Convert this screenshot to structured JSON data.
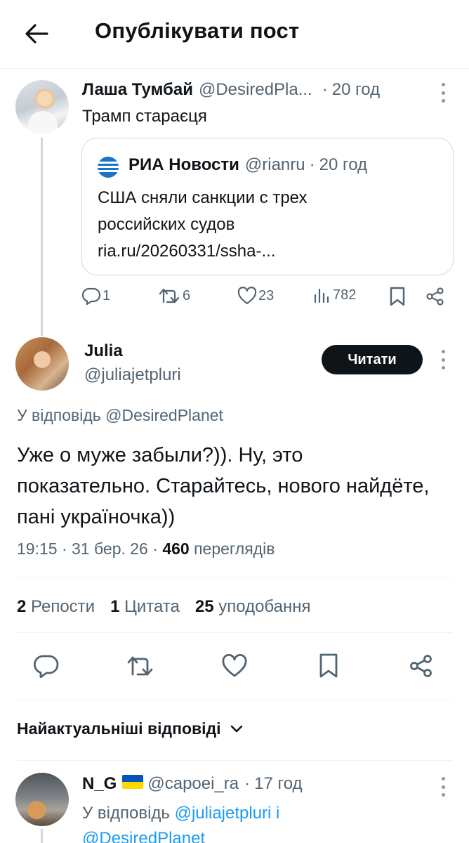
{
  "header": {
    "title": "Опублікувати пост",
    "back_icon": "arrow-left-icon"
  },
  "parent_post": {
    "name": "Лаша Тумбай",
    "handle": "@DesiredPla...",
    "time": "20 год",
    "text": "Трамп стараєця",
    "quote": {
      "name": "РИА Новости",
      "handle": "@rianru",
      "time": "20 год",
      "text_line1": "США сняли санкции с трех",
      "text_line2": "российских судов",
      "link": "ria.ru/20260331/ssha-..."
    },
    "actions": {
      "replies": "1",
      "reposts": "6",
      "likes": "23",
      "views": "782"
    }
  },
  "main_post": {
    "name": "Julia",
    "handle": "@juliajetpluri",
    "follow_button": "Читати",
    "reply_to": "У відповідь @DesiredPlanet",
    "text": "Уже о муже забыли?)). Ну, это показательно. Старайтесь, нового найдёте, пані україночка))",
    "time": "19:15",
    "date": "31 бер. 26",
    "views": "460",
    "views_label": "переглядів",
    "stats": {
      "reposts_count": "2",
      "reposts_label": "Репости",
      "quotes_count": "1",
      "quotes_label": "Цитата",
      "likes_count": "25",
      "likes_label": "уподобання"
    }
  },
  "replies_header": {
    "label": "Найактуальніші відповіді"
  },
  "reply_post": {
    "name": "N_G",
    "handle": "@capoei_ra",
    "time": "17 год",
    "reply_prefix": "У відповідь",
    "reply_user1": "@juliajetpluri",
    "reply_and": "і",
    "reply_user2": "@DesiredPlanet"
  },
  "colors": {
    "text": "#0f1419",
    "secondary": "#536471",
    "link": "#1d9bf0",
    "border": "#cfd9de",
    "button": "#0f1419",
    "ria": "#1a73c7"
  }
}
